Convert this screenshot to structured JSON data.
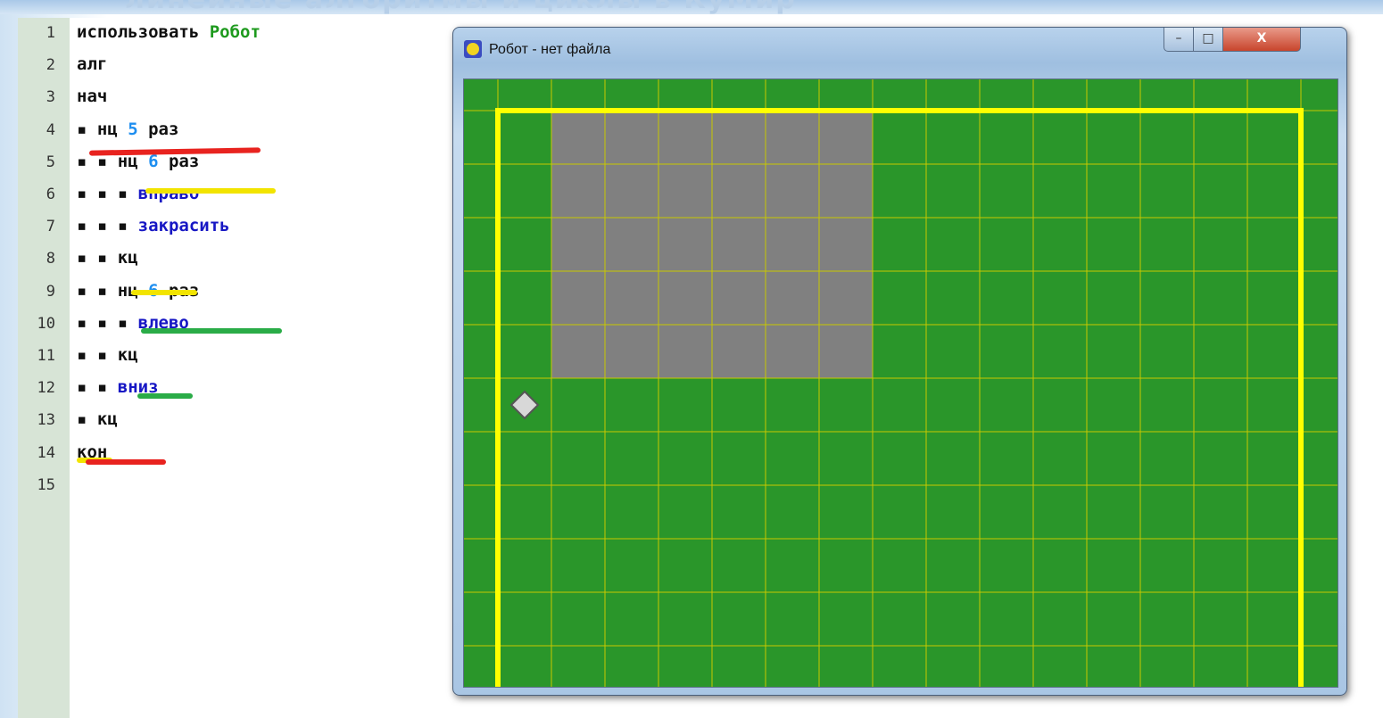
{
  "header": {
    "faded_title": "линейные алгоритмы и циклы в КуМир"
  },
  "editor": {
    "lines": [
      {
        "num": "1",
        "dots": "",
        "parts": [
          {
            "t": "использовать ",
            "c": "kw"
          },
          {
            "t": "Робот",
            "c": "green"
          }
        ]
      },
      {
        "num": "2",
        "dots": "",
        "parts": [
          {
            "t": "алг",
            "c": "kw"
          }
        ]
      },
      {
        "num": "3",
        "dots": "",
        "parts": [
          {
            "t": "нач",
            "c": "kw"
          }
        ]
      },
      {
        "num": "4",
        "dots": "▪ ",
        "parts": [
          {
            "t": "нц ",
            "c": "kw"
          },
          {
            "t": "5",
            "c": "num"
          },
          {
            "t": " раз",
            "c": "kw"
          }
        ]
      },
      {
        "num": "5",
        "dots": "▪ ▪ ",
        "parts": [
          {
            "t": "нц ",
            "c": "kw"
          },
          {
            "t": "6",
            "c": "num"
          },
          {
            "t": " раз",
            "c": "kw"
          }
        ]
      },
      {
        "num": "6",
        "dots": "▪ ▪ ▪ ",
        "parts": [
          {
            "t": "вправо",
            "c": "blue"
          }
        ]
      },
      {
        "num": "7",
        "dots": "▪ ▪ ▪ ",
        "parts": [
          {
            "t": "закрасить",
            "c": "blue"
          }
        ]
      },
      {
        "num": "8",
        "dots": "▪ ▪ ",
        "parts": [
          {
            "t": "кц",
            "c": "kw"
          }
        ]
      },
      {
        "num": "9",
        "dots": "▪ ▪ ",
        "parts": [
          {
            "t": "нц ",
            "c": "kw"
          },
          {
            "t": "6",
            "c": "num"
          },
          {
            "t": " раз",
            "c": "kw"
          }
        ]
      },
      {
        "num": "10",
        "dots": "▪ ▪ ▪ ",
        "parts": [
          {
            "t": "влево",
            "c": "blue"
          }
        ]
      },
      {
        "num": "11",
        "dots": "▪ ▪ ",
        "parts": [
          {
            "t": "кц",
            "c": "kw"
          }
        ]
      },
      {
        "num": "12",
        "dots": "▪ ▪ ",
        "parts": [
          {
            "t": "вниз",
            "c": "blue"
          }
        ]
      },
      {
        "num": "13",
        "dots": "▪ ",
        "parts": [
          {
            "t": "кц",
            "c": "kw"
          }
        ]
      },
      {
        "num": "14",
        "dots": "",
        "parts": [
          {
            "t": "кон",
            "c": "kw"
          }
        ]
      },
      {
        "num": "15",
        "dots": "",
        "parts": []
      }
    ],
    "highlight_colors": {
      "outer_loop": "#e8231f",
      "first_inner_loop": "#f2e400",
      "second_inner_loop": "#2aac47"
    }
  },
  "robot_window": {
    "title": "Робот - нет файла",
    "icon": "robot-smiley-icon",
    "buttons": {
      "minimize": "–",
      "maximize": "□",
      "close": "X"
    },
    "field": {
      "columns": 15,
      "rows": 11,
      "background": "#2a962a",
      "grid_color": "#c8c800",
      "wall_color": "#ffff00",
      "painted_color": "#808080",
      "painted_cells": {
        "columns": "2-7",
        "rows": "1-5"
      },
      "robot_cell": {
        "column": 1,
        "row": 6
      }
    }
  }
}
